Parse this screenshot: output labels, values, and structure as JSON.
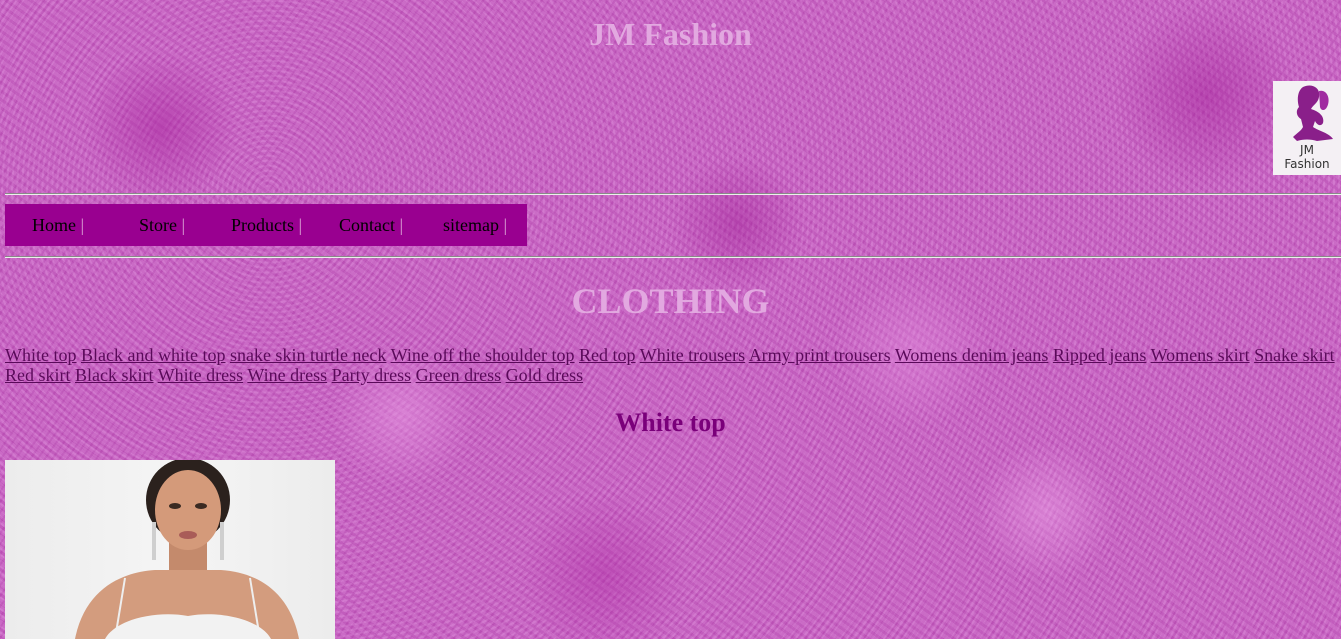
{
  "header": {
    "site_title": "JM Fashion",
    "logo_text": "JM\nFashion"
  },
  "nav": {
    "items": [
      {
        "label": "Home",
        "sep": "|"
      },
      {
        "label": "Store",
        "sep": "|"
      },
      {
        "label": "Products",
        "sep": "|"
      },
      {
        "label": "Contact",
        "sep": "|"
      },
      {
        "label": "sitemap",
        "sep": "|"
      }
    ]
  },
  "main": {
    "section_heading": "CLOTHING",
    "product_links": [
      "White top",
      "Black and white top",
      "snake skin turtle neck",
      "Wine off the shoulder top",
      "Red top",
      "White trousers",
      "Army print trousers",
      "Womens denim jeans",
      "Ripped jeans",
      "Womens skirt",
      "Snake skirt",
      "Red skirt",
      "Black skirt",
      "White dress",
      "Wine dress",
      "Party dress",
      "Green dress",
      "Gold dress"
    ],
    "product_title": "White top"
  },
  "colors": {
    "background": "#c863c4",
    "nav_background": "#990090",
    "title_color": "#e2a8e0",
    "link_color": "#5a0a5a",
    "product_title_color": "#7a007a"
  }
}
